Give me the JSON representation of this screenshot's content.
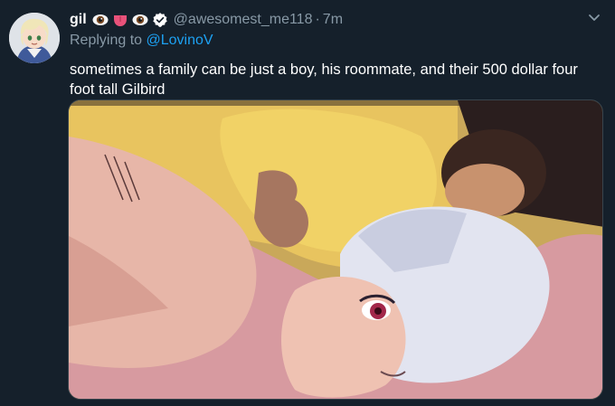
{
  "tweet": {
    "display_name": "gil",
    "name_emojis": [
      "eye-emoji",
      "tongue-emoji",
      "eye-emoji"
    ],
    "verified_icon": "verified-badge-icon",
    "handle": "@awesomest_me118",
    "separator": "·",
    "time": "7m",
    "reply_prefix": "Replying to ",
    "reply_mention": "@LovinoV",
    "text": "sometimes a family can be just a boy, his roommate, and their 500 dollar four foot tall Gilbird",
    "menu_icon": "chevron-down-icon",
    "media": {
      "type": "illustration",
      "icon": "illustration-image"
    }
  },
  "colors": {
    "background": "#15202b",
    "secondary_text": "#8899a6",
    "link": "#1da1f2",
    "border": "#38444d"
  }
}
